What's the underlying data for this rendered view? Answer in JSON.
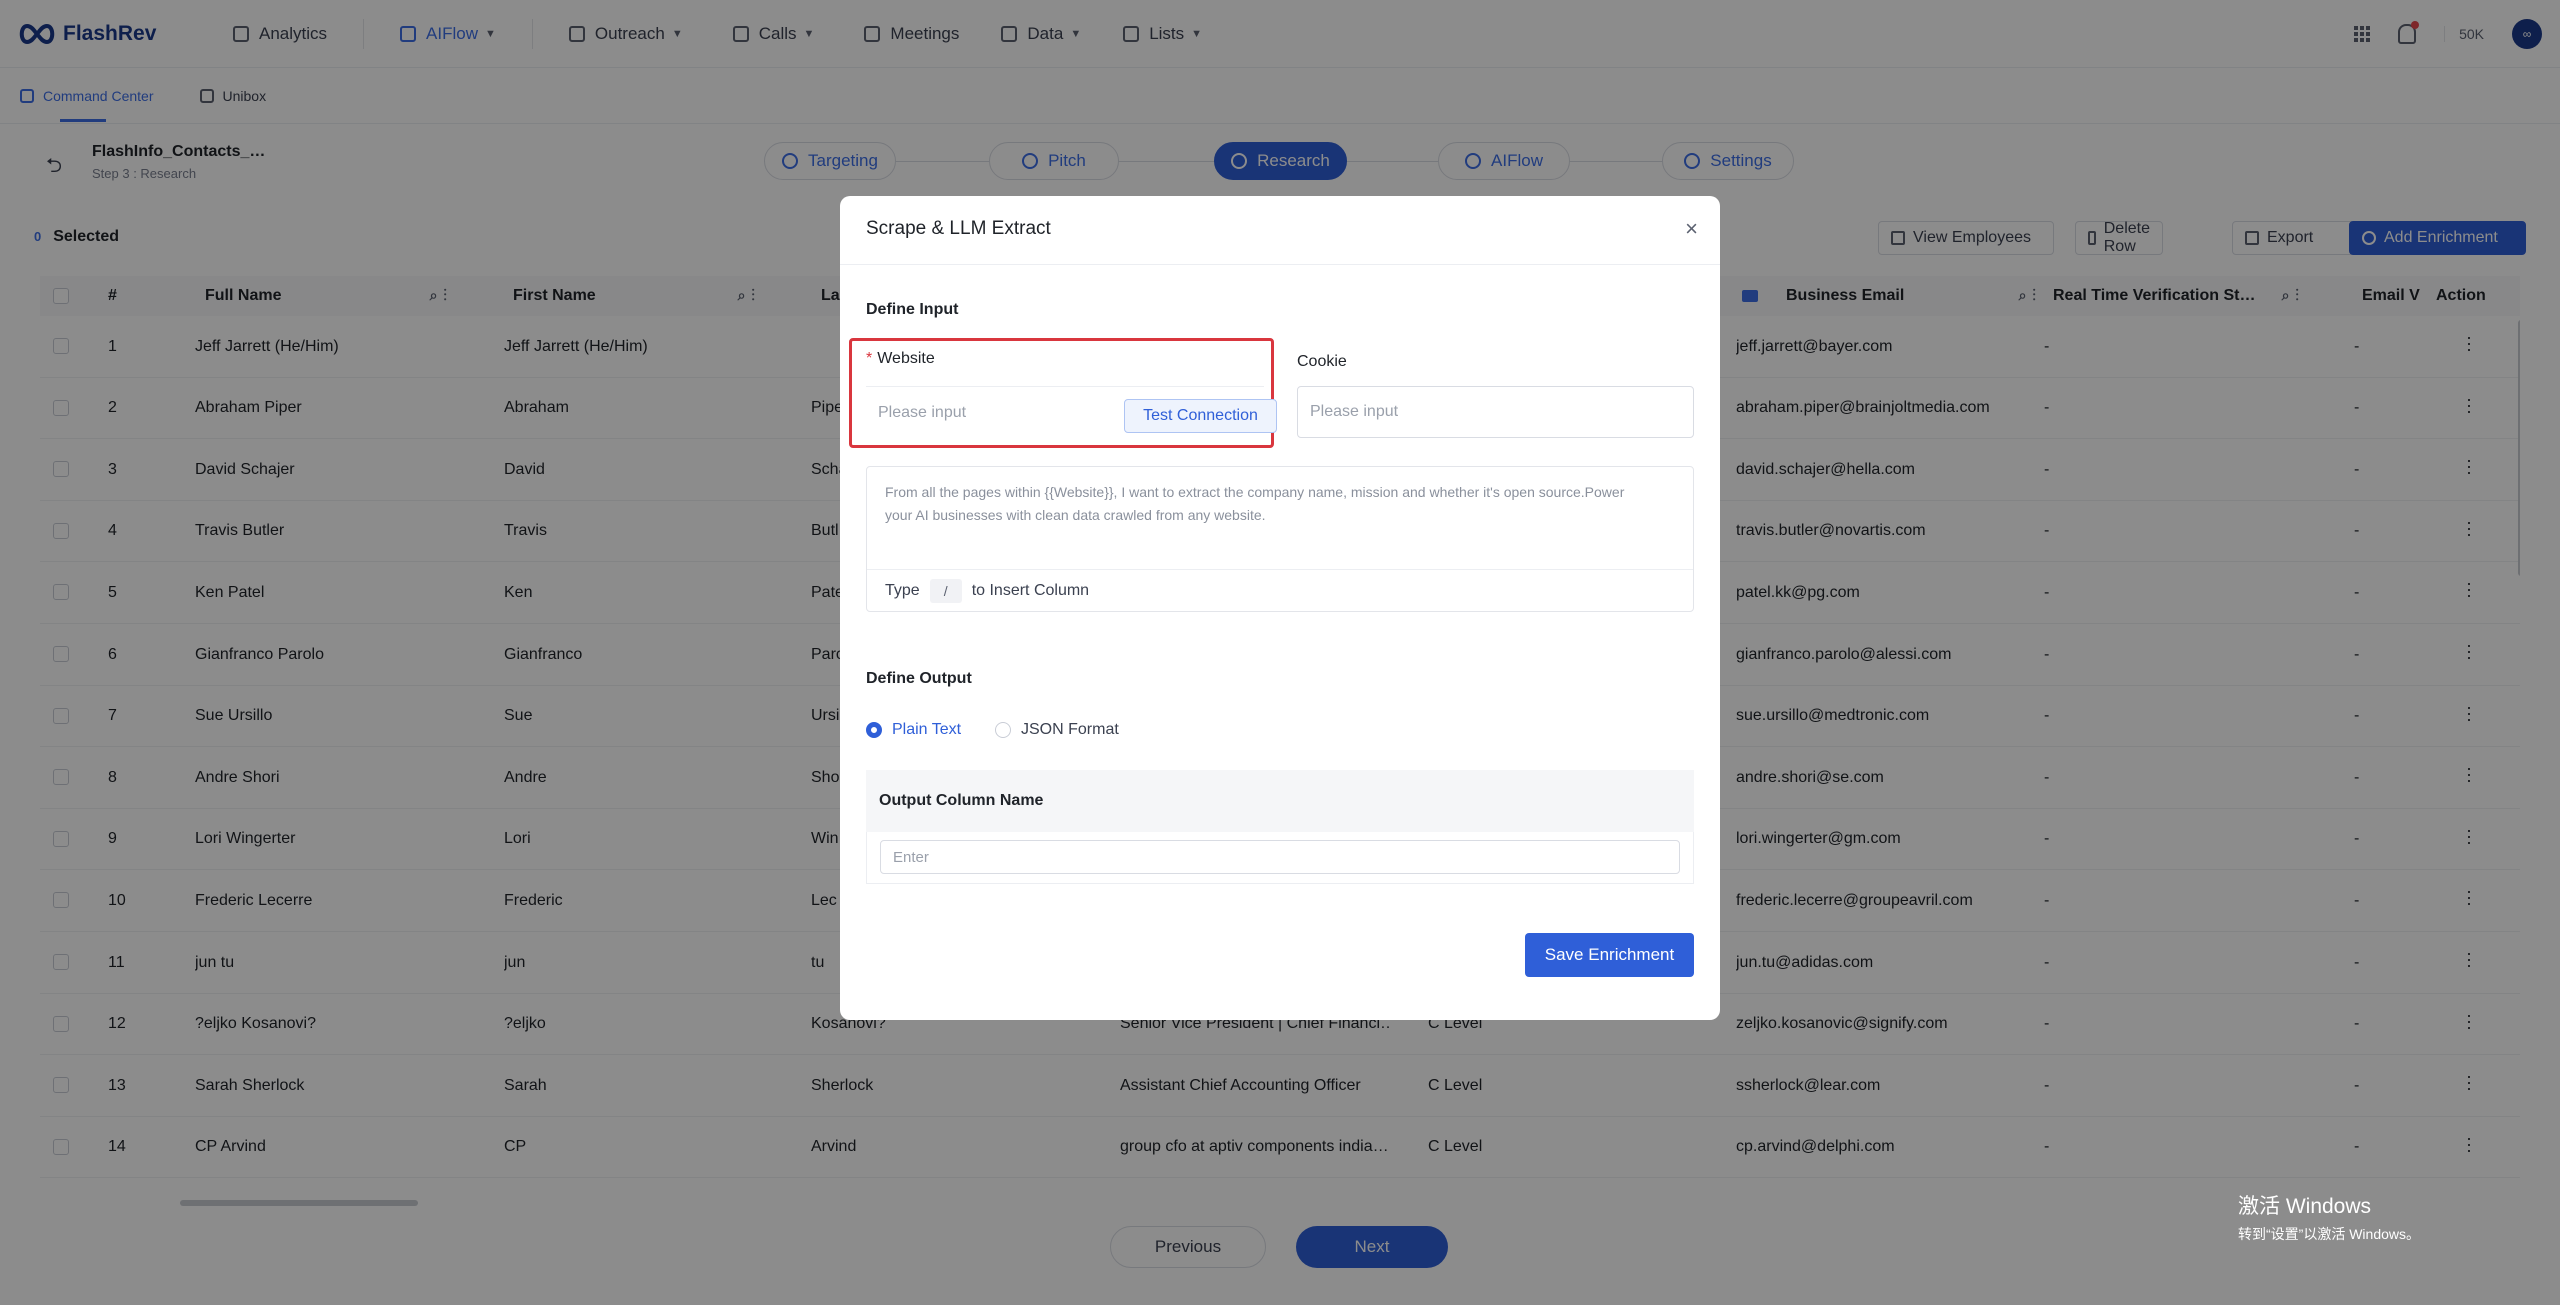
{
  "app": {
    "brand": "FlashRev",
    "nav": [
      {
        "label": "Analytics",
        "chevron": false
      },
      {
        "label": "AIFlow",
        "chevron": true,
        "active": true
      },
      {
        "label": "Outreach",
        "chevron": true
      },
      {
        "label": "Calls",
        "chevron": true
      },
      {
        "label": "Meetings",
        "chevron": false
      },
      {
        "label": "Data",
        "chevron": true
      },
      {
        "label": "Lists",
        "chevron": true
      }
    ],
    "credits": "50K",
    "avatar_text": "∞"
  },
  "subnav": [
    {
      "label": "Command Center",
      "active": true
    },
    {
      "label": "Unibox"
    }
  ],
  "project": {
    "name": "FlashInfo_Contacts_…",
    "step": "Step 3 : Research"
  },
  "steps": [
    {
      "label": "Targeting"
    },
    {
      "label": "Pitch"
    },
    {
      "label": "Research",
      "active": true
    },
    {
      "label": "AIFlow"
    },
    {
      "label": "Settings"
    }
  ],
  "toolbar": {
    "selected_count": "0",
    "selected_label": "Selected",
    "view_employees": "View Employees",
    "delete_row": "Delete Row",
    "export": "Export",
    "add_enrichment": "Add Enrichment"
  },
  "table": {
    "headers": [
      "#",
      "Full Name",
      "First Name",
      "La",
      "Business Email",
      "Real Time Verification St…",
      "Email V",
      "Action"
    ],
    "rows": [
      {
        "n": "1",
        "full": "Jeff Jarrett (He/Him)",
        "first": "Jeff Jarrett (He/Him)",
        "last": "",
        "title": "",
        "level": "",
        "email": "jeff.jarrett@bayer.com"
      },
      {
        "n": "2",
        "full": "Abraham Piper",
        "first": "Abraham",
        "last": "Pipe",
        "title": "",
        "level": "",
        "email": "abraham.piper@brainjoltmedia.com"
      },
      {
        "n": "3",
        "full": "David Schajer",
        "first": "David",
        "last": "Scha",
        "title": "",
        "level": "",
        "email": "david.schajer@hella.com"
      },
      {
        "n": "4",
        "full": "Travis Butler",
        "first": "Travis",
        "last": "Butl",
        "title": "",
        "level": "",
        "email": "travis.butler@novartis.com"
      },
      {
        "n": "5",
        "full": "Ken Patel",
        "first": "Ken",
        "last": "Pate",
        "title": "",
        "level": "",
        "email": "patel.kk@pg.com"
      },
      {
        "n": "6",
        "full": "Gianfranco Parolo",
        "first": "Gianfranco",
        "last": "Paro",
        "title": "",
        "level": "",
        "email": "gianfranco.parolo@alessi.com"
      },
      {
        "n": "7",
        "full": "Sue Ursillo",
        "first": "Sue",
        "last": "Ursi",
        "title": "",
        "level": "",
        "email": "sue.ursillo@medtronic.com"
      },
      {
        "n": "8",
        "full": "Andre Shori",
        "first": "Andre",
        "last": "Sho",
        "title": "",
        "level": "",
        "email": "andre.shori@se.com"
      },
      {
        "n": "9",
        "full": "Lori Wingerter",
        "first": "Lori",
        "last": "Win",
        "title": "",
        "level": "",
        "email": "lori.wingerter@gm.com"
      },
      {
        "n": "10",
        "full": "Frederic Lecerre",
        "first": "Frederic",
        "last": "Lec",
        "title": "",
        "level": "",
        "email": "frederic.lecerre@groupeavril.com"
      },
      {
        "n": "11",
        "full": "jun tu",
        "first": "jun",
        "last": "tu",
        "title": "",
        "level": "",
        "email": "jun.tu@adidas.com"
      },
      {
        "n": "12",
        "full": "?eljko Kosanovi?",
        "first": "?eljko",
        "last": "Kosanovi?",
        "title": "Senior Vice President | Chief Financi…",
        "level": "C Level",
        "email": "zeljko.kosanovic@signify.com"
      },
      {
        "n": "13",
        "full": "Sarah Sherlock",
        "first": "Sarah",
        "last": "Sherlock",
        "title": "Assistant Chief Accounting Officer",
        "level": "C Level",
        "email": "ssherlock@lear.com"
      },
      {
        "n": "14",
        "full": "CP Arvind",
        "first": "CP",
        "last": "Arvind",
        "title": "group cfo at aptiv components india…",
        "level": "C Level",
        "email": "cp.arvind@delphi.com"
      }
    ],
    "dash": "-"
  },
  "pager": {
    "previous": "Previous",
    "next": "Next"
  },
  "watermark": {
    "line1": "激活 Windows",
    "line2": "转到“设置”以激活 Windows。"
  },
  "modal": {
    "title": "Scrape & LLM Extract",
    "close": "×",
    "define_input": "Define Input",
    "website_label": "Website",
    "required_mark": "*",
    "website_placeholder": "Please input",
    "test_connection": "Test Connection",
    "cookie_label": "Cookie",
    "cookie_placeholder": "Please input",
    "prompt_placeholder": "From all the pages within {{Website}}, I want to extract the company name, mission and whether it's open source.Power your AI businesses with clean data crawled from any website.",
    "insert_hint_pre": "Type",
    "insert_hint_key": "/",
    "insert_hint_post": "to Insert Column",
    "define_output": "Define Output",
    "format_plain": "Plain Text",
    "format_json": "JSON Format",
    "output_column_name": "Output Column Name",
    "output_placeholder": "Enter",
    "save": "Save Enrichment"
  }
}
